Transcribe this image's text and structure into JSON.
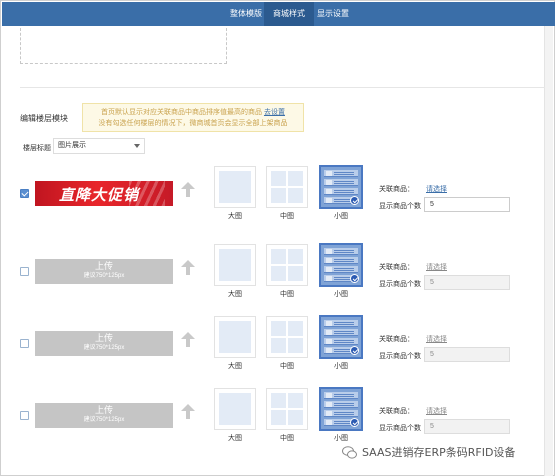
{
  "tabs": [
    {
      "label": "整体模版",
      "active": false
    },
    {
      "label": "商城样式",
      "active": true
    },
    {
      "label": "显示设置",
      "active": false
    }
  ],
  "section": {
    "title": "编辑楼层模块",
    "notice_line1": "首页默认显示对应关联商品中商品排序值最高的商品",
    "notice_link": "去设置",
    "notice_line2": "没有勾选任何楼层的情况下，微商城首页会显示全部上架商品"
  },
  "floor_title": {
    "label": "楼层标题",
    "value": "图片展示"
  },
  "layout_captions": {
    "big": "大图",
    "mid": "中图",
    "small": "小图"
  },
  "fields": {
    "related_label": "关联商品：",
    "related_link": "请选择",
    "count_label": "显示商品个数"
  },
  "rows": [
    {
      "checked": true,
      "banner_text": "直降大促销",
      "upload_title": "",
      "upload_hint": "",
      "count": "5"
    },
    {
      "checked": false,
      "banner_text": "",
      "upload_title": "上传",
      "upload_hint": "建议750*125px",
      "count": "5"
    },
    {
      "checked": false,
      "banner_text": "",
      "upload_title": "上传",
      "upload_hint": "建议750*125px",
      "count": "5"
    },
    {
      "checked": false,
      "banner_text": "",
      "upload_title": "上传",
      "upload_hint": "建议750*125px",
      "count": "5"
    }
  ],
  "watermark": "SAAS进销存ERP条码RFID设备",
  "colors": {
    "header": "#3a6ea8",
    "accent": "#4a78c2",
    "banner_red": "#e8262b"
  }
}
